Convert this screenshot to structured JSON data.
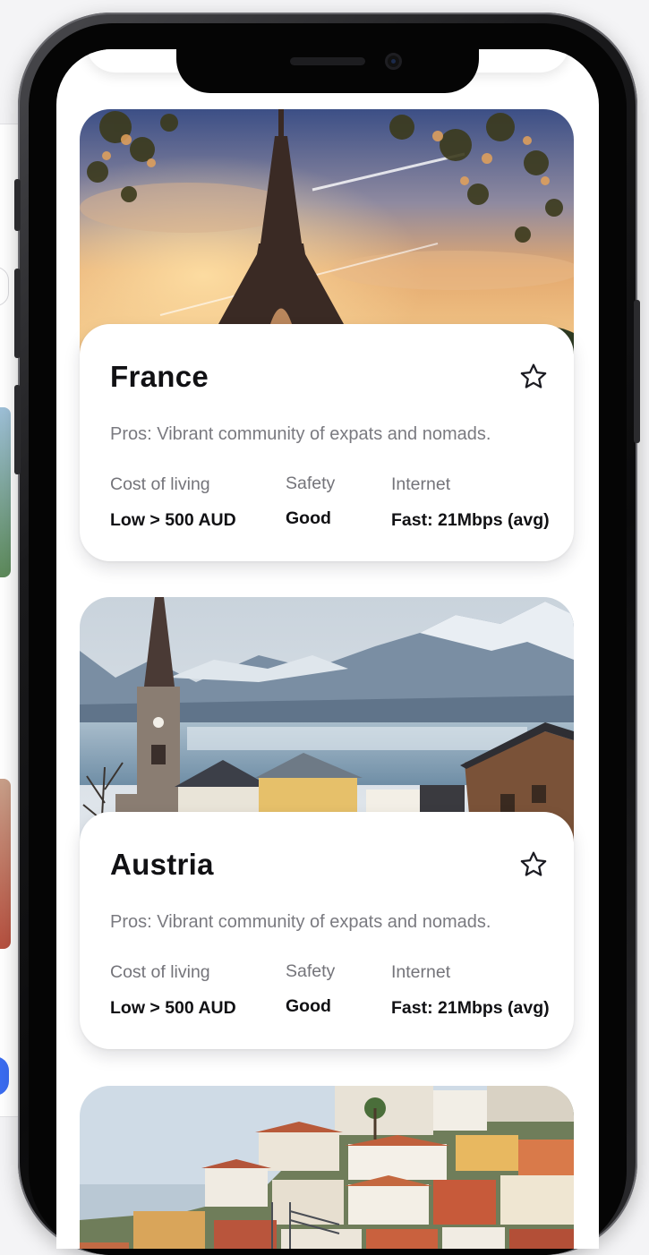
{
  "destinations": [
    {
      "country": "France",
      "pros": "Pros: Vibrant community of expats and nomads.",
      "cost_label": "Cost of living",
      "cost_value": "Low > 500 AUD",
      "safety_label": "Safety",
      "safety_value": "Good",
      "internet_label": "Internet",
      "internet_value": "Fast: 21Mbps (avg)",
      "favorite_icon": "star-outline-icon",
      "photo": "eiffel-tower-photo"
    },
    {
      "country": "Austria",
      "pros": "Pros: Vibrant community of expats and nomads.",
      "cost_label": "Cost of living",
      "cost_value": "Low > 500 AUD",
      "safety_label": "Safety",
      "safety_value": "Good",
      "internet_label": "Internet",
      "internet_value": "Fast: 21Mbps (avg)",
      "favorite_icon": "star-outline-icon",
      "photo": "hallstatt-lake-photo"
    },
    {
      "photo": "porto-hillside-photo"
    }
  ],
  "colors": {
    "title": "#111114",
    "muted_text": "#74747a",
    "card_bg": "#ffffff",
    "frame": "#0b0b0c"
  }
}
